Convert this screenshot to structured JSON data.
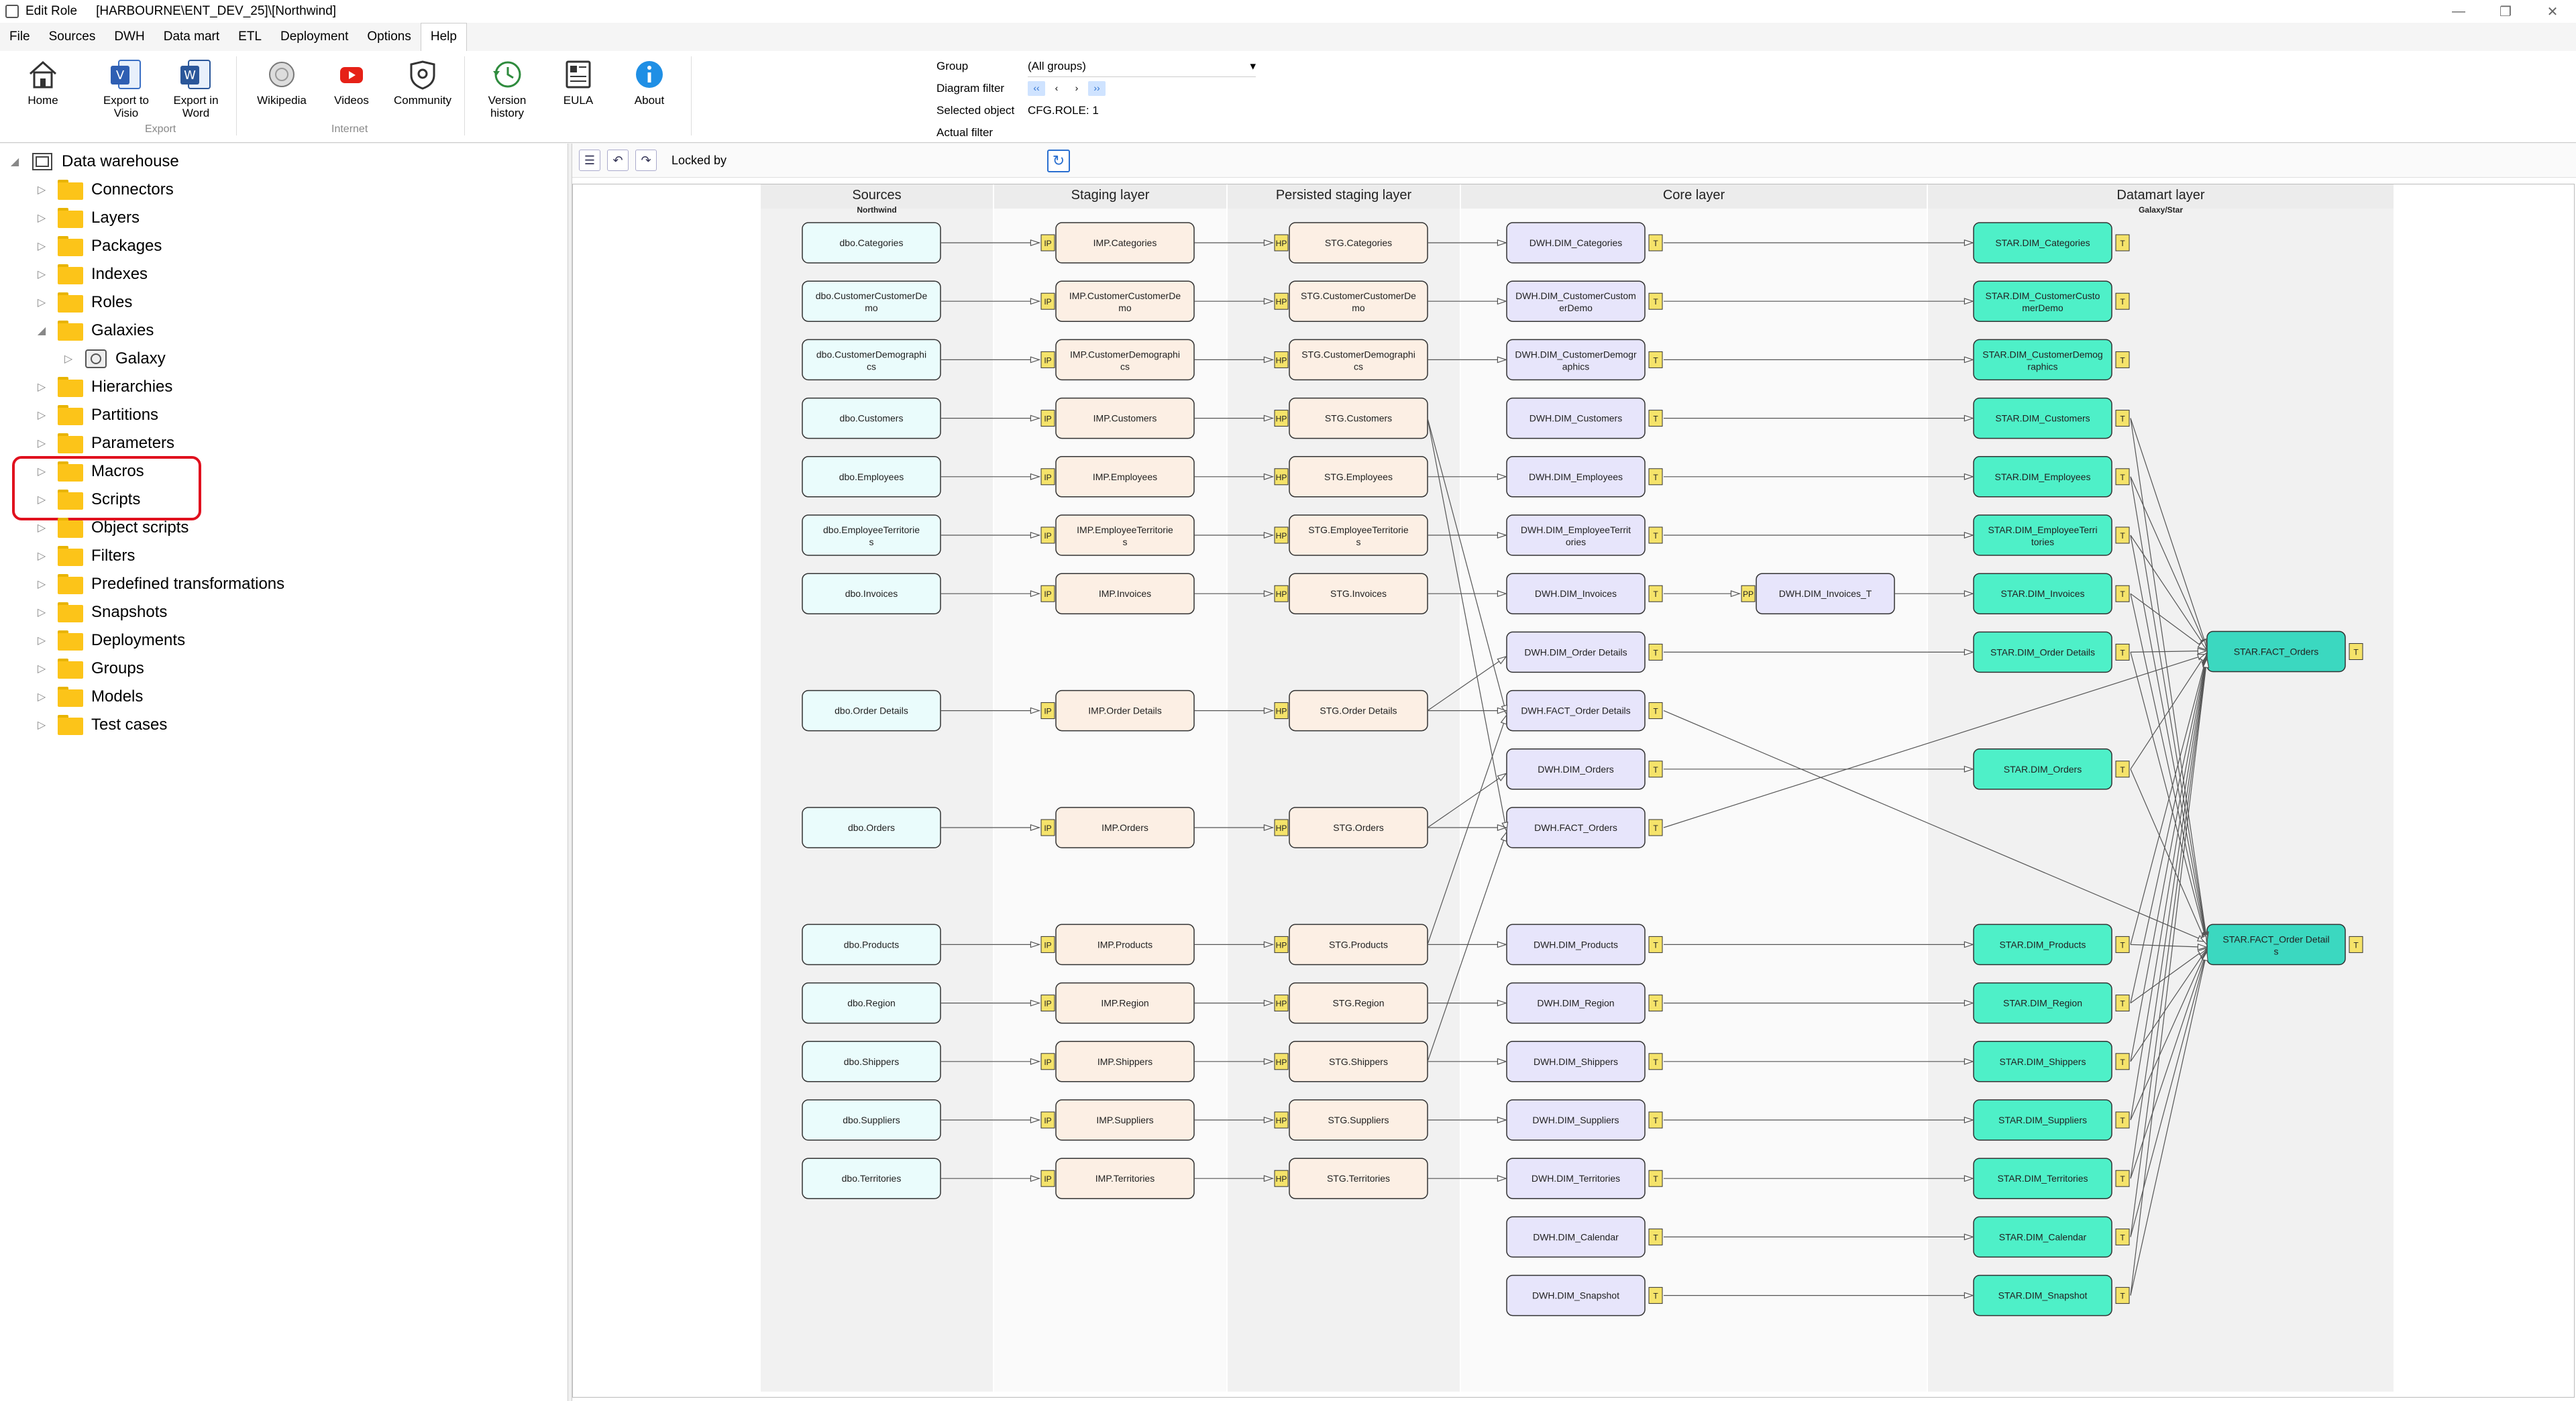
{
  "window": {
    "title_app": "Edit Role",
    "title_path": "[HARBOURNE\\ENT_DEV_25]\\[Northwind]"
  },
  "menu": [
    "File",
    "Sources",
    "DWH",
    "Data mart",
    "ETL",
    "Deployment",
    "Options",
    "Help"
  ],
  "ribbon": {
    "buttons": [
      {
        "label": "Home",
        "icon": "home-icon"
      },
      {
        "label": "Export to Visio",
        "icon": "visio-icon"
      },
      {
        "label": "Export in Word",
        "icon": "word-icon"
      },
      {
        "label": "Wikipedia",
        "icon": "wikipedia-icon"
      },
      {
        "label": "Videos",
        "icon": "youtube-icon"
      },
      {
        "label": "Community",
        "icon": "community-icon"
      },
      {
        "label": "Version history",
        "icon": "history-icon"
      },
      {
        "label": "EULA",
        "icon": "eula-icon"
      },
      {
        "label": "About",
        "icon": "info-icon"
      }
    ],
    "groups": {
      "export": "Export",
      "internet": "Internet"
    },
    "filters": {
      "group_label": "Group",
      "group_value": "(All groups)",
      "diagram_filter_label": "Diagram filter",
      "selected_object_label": "Selected object",
      "selected_object_value": "CFG.ROLE: 1",
      "actual_filter_label": "Actual filter"
    }
  },
  "tree": {
    "root": "Data warehouse",
    "items": [
      "Connectors",
      "Layers",
      "Packages",
      "Indexes",
      "Roles",
      "Galaxies",
      "Hierarchies",
      "Partitions",
      "Parameters",
      "Macros",
      "Scripts",
      "Object scripts",
      "Filters",
      "Predefined transformations",
      "Snapshots",
      "Deployments",
      "Groups",
      "Models",
      "Test cases"
    ],
    "child_of_galaxies": "Galaxy"
  },
  "diagram": {
    "locked_by_label": "Locked by",
    "layers": [
      {
        "title": "Sources",
        "subtitle": "Northwind"
      },
      {
        "title": "Staging layer",
        "subtitle": ""
      },
      {
        "title": "Persisted staging layer",
        "subtitle": ""
      },
      {
        "title": "Core layer",
        "subtitle": ""
      },
      {
        "title": "Datamart layer",
        "subtitle": "Galaxy/Star"
      }
    ],
    "rows": [
      {
        "src": "dbo.Categories",
        "imp": "IMP.Categories",
        "stg": "STG.Categories",
        "dwh": "DWH.DIM_Categories",
        "star": "STAR.DIM_Categories"
      },
      {
        "src": "dbo.CustomerCustomerDemo",
        "imp": "IMP.CustomerCustomerDemo",
        "stg": "STG.CustomerCustomerDemo",
        "dwh": "DWH.DIM_CustomerCustomerDemo",
        "star": "STAR.DIM_CustomerCustomerDemo"
      },
      {
        "src": "dbo.CustomerDemographics",
        "imp": "IMP.CustomerDemographics",
        "stg": "STG.CustomerDemographics",
        "dwh": "DWH.DIM_CustomerDemographics",
        "star": "STAR.DIM_CustomerDemographics"
      },
      {
        "src": "dbo.Customers",
        "imp": "IMP.Customers",
        "stg": "STG.Customers",
        "dwh": "DWH.DIM_Customers",
        "star": "STAR.DIM_Customers"
      },
      {
        "src": "dbo.Employees",
        "imp": "IMP.Employees",
        "stg": "STG.Employees",
        "dwh": "DWH.DIM_Employees",
        "star": "STAR.DIM_Employees"
      },
      {
        "src": "dbo.EmployeeTerritories",
        "imp": "IMP.EmployeeTerritories",
        "stg": "STG.EmployeeTerritories",
        "dwh": "DWH.DIM_EmployeeTerritories",
        "star": "STAR.DIM_EmployeeTerritories"
      },
      {
        "src": "dbo.Invoices",
        "imp": "IMP.Invoices",
        "stg": "STG.Invoices",
        "dwh": "DWH.DIM_Invoices",
        "star": "STAR.DIM_Invoices",
        "extra": "DWH.DIM_Invoices_T"
      },
      {
        "src": "",
        "imp": "",
        "stg": "",
        "dwh": "DWH.DIM_Order Details",
        "star": "STAR.DIM_Order Details"
      },
      {
        "src": "dbo.Order Details",
        "imp": "IMP.Order Details",
        "stg": "STG.Order Details",
        "dwh": "DWH.FACT_Order Details",
        "star": ""
      },
      {
        "src": "",
        "imp": "",
        "stg": "",
        "dwh": "DWH.DIM_Orders",
        "star": "STAR.DIM_Orders"
      },
      {
        "src": "dbo.Orders",
        "imp": "IMP.Orders",
        "stg": "STG.Orders",
        "dwh": "DWH.FACT_Orders",
        "star": ""
      },
      {
        "src": "",
        "imp": "",
        "stg": "",
        "dwh": "",
        "star": ""
      },
      {
        "src": "dbo.Products",
        "imp": "IMP.Products",
        "stg": "STG.Products",
        "dwh": "DWH.DIM_Products",
        "star": "STAR.DIM_Products"
      },
      {
        "src": "dbo.Region",
        "imp": "IMP.Region",
        "stg": "STG.Region",
        "dwh": "DWH.DIM_Region",
        "star": "STAR.DIM_Region"
      },
      {
        "src": "dbo.Shippers",
        "imp": "IMP.Shippers",
        "stg": "STG.Shippers",
        "dwh": "DWH.DIM_Shippers",
        "star": "STAR.DIM_Shippers"
      },
      {
        "src": "dbo.Suppliers",
        "imp": "IMP.Suppliers",
        "stg": "STG.Suppliers",
        "dwh": "DWH.DIM_Suppliers",
        "star": "STAR.DIM_Suppliers"
      },
      {
        "src": "dbo.Territories",
        "imp": "IMP.Territories",
        "stg": "STG.Territories",
        "dwh": "DWH.DIM_Territories",
        "star": "STAR.DIM_Territories"
      },
      {
        "src": "",
        "imp": "",
        "stg": "",
        "dwh": "DWH.DIM_Calendar",
        "star": "STAR.DIM_Calendar"
      },
      {
        "src": "",
        "imp": "",
        "stg": "",
        "dwh": "DWH.DIM_Snapshot",
        "star": "STAR.DIM_Snapshot"
      }
    ],
    "facts": [
      "STAR.FACT_Orders",
      "STAR.FACT_Order Details"
    ],
    "badges": {
      "imp": "IP",
      "stg": "HP",
      "core": "T",
      "extra": "PP"
    },
    "colors": {
      "source": "#eafcfc",
      "imp": "#fcefe4",
      "stg": "#fcefe4",
      "core": "#e7e5fb",
      "star": "#4ef0c8",
      "fact": "#3bd8c0",
      "badge": "#f5e36a"
    }
  }
}
